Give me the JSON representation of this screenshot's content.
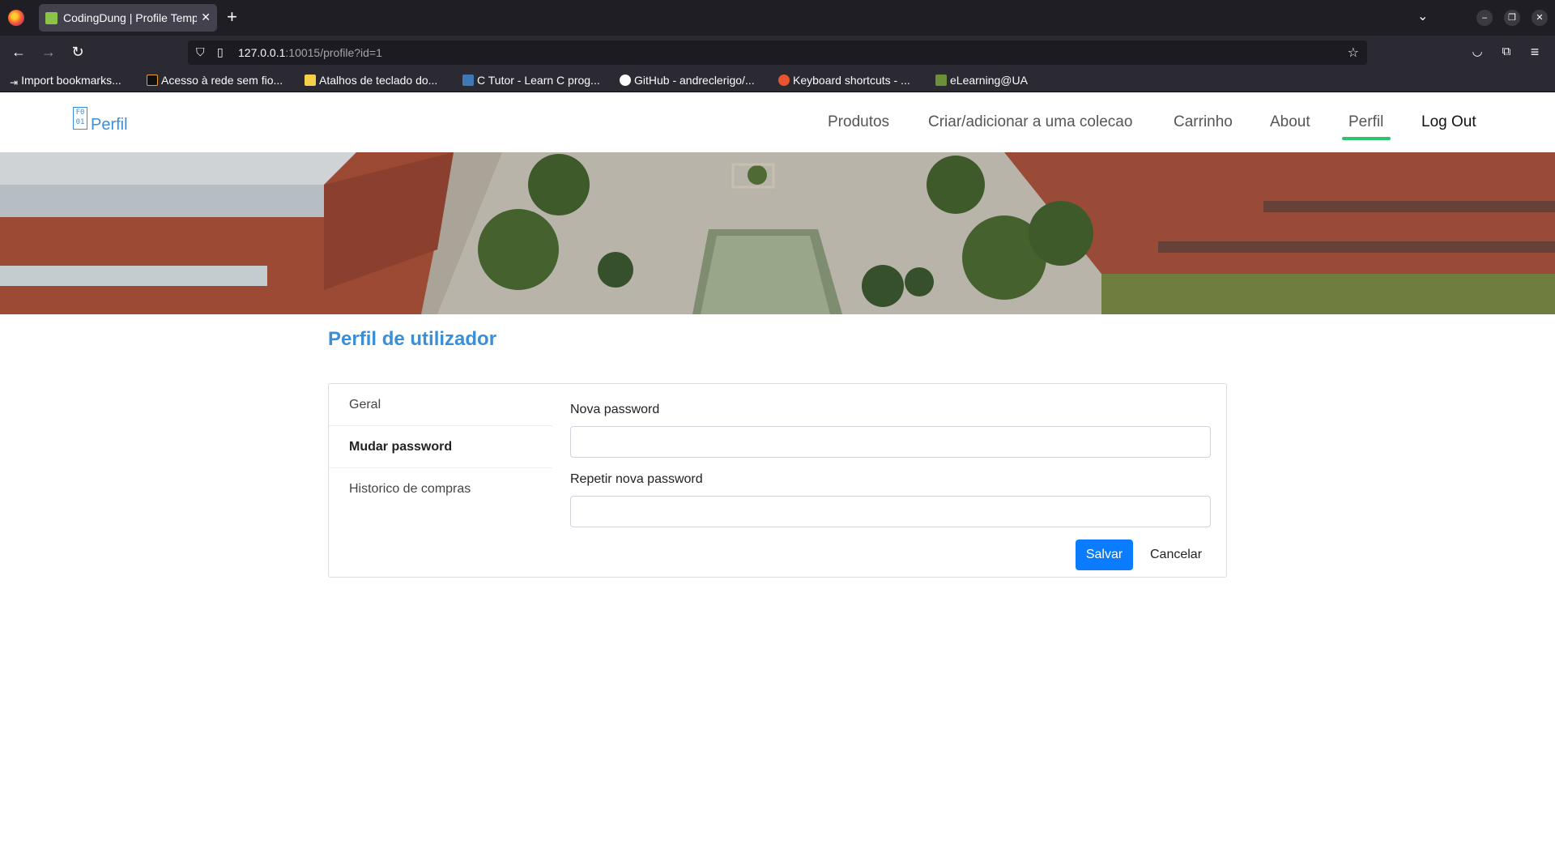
{
  "browser": {
    "tab_title": "CodingDung | Profile Template",
    "url_host": "127.0.0.1",
    "url_rest": ":10015/profile?id=1",
    "bookmarks": [
      "Import bookmarks...",
      "Acesso à rede sem fio...",
      "Atalhos de teclado do...",
      "C Tutor - Learn C prog...",
      "GitHub - andreclerigo/...",
      "Keyboard shortcuts - ...",
      "eLearning@UA"
    ]
  },
  "header": {
    "brand_icon_text": "F0 01",
    "brand": "Perfil",
    "menu": [
      "Produtos",
      "Criar/adicionar a uma colecao",
      "Carrinho",
      "About",
      "Perfil",
      "Log Out"
    ],
    "active_item": "Perfil"
  },
  "main": {
    "title": "Perfil de utilizador",
    "sidebar": [
      "Geral",
      "Mudar password",
      "Historico de compras"
    ],
    "active_tab": "Mudar password",
    "form": {
      "new_password_label": "Nova password",
      "new_password_value": "",
      "repeat_password_label": "Repetir nova password",
      "repeat_password_value": "",
      "save_label": "Salvar",
      "cancel_label": "Cancelar"
    }
  },
  "colors": {
    "accent": "#3a8fd8",
    "active_underline": "#2cc36b",
    "save_button": "#0b7cff"
  },
  "icons": [
    "firefox-icon",
    "back-icon",
    "forward-icon",
    "reload-icon",
    "shield-icon",
    "page-icon",
    "star-icon",
    "pocket-icon",
    "extensions-icon",
    "menu-icon"
  ]
}
